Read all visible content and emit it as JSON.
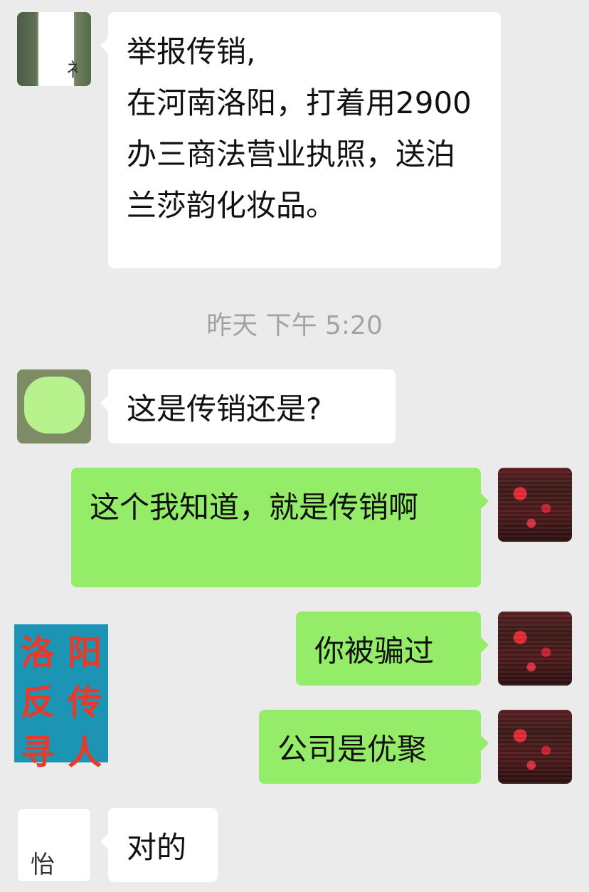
{
  "messages": [
    {
      "side": "left",
      "text": "举报传销,\n在河南洛阳，打着用2900办三商法营业执照，送泊兰莎韵化妆品。"
    },
    {
      "side": "left",
      "text": "这是传销还是?"
    },
    {
      "side": "right",
      "text": "这个我知道，就是传销啊"
    },
    {
      "side": "right",
      "text": "你被骗过"
    },
    {
      "side": "right",
      "text": "公司是优聚"
    },
    {
      "side": "left",
      "text": "对的"
    }
  ],
  "timestamp": "昨天 下午 5:20",
  "watermark": {
    "chars": [
      "洛",
      "阳",
      "反",
      "传",
      "寻",
      "人"
    ]
  },
  "avatars": {
    "first_left_glyph": "衤",
    "last_left_glyph": "怡"
  },
  "colors": {
    "background": "#ebebeb",
    "incoming_bubble": "#ffffff",
    "outgoing_bubble": "#95ec69",
    "timestamp_text": "#a3a3a3",
    "watermark_bg": "#1b95b3",
    "watermark_text": "#e83a2a"
  }
}
